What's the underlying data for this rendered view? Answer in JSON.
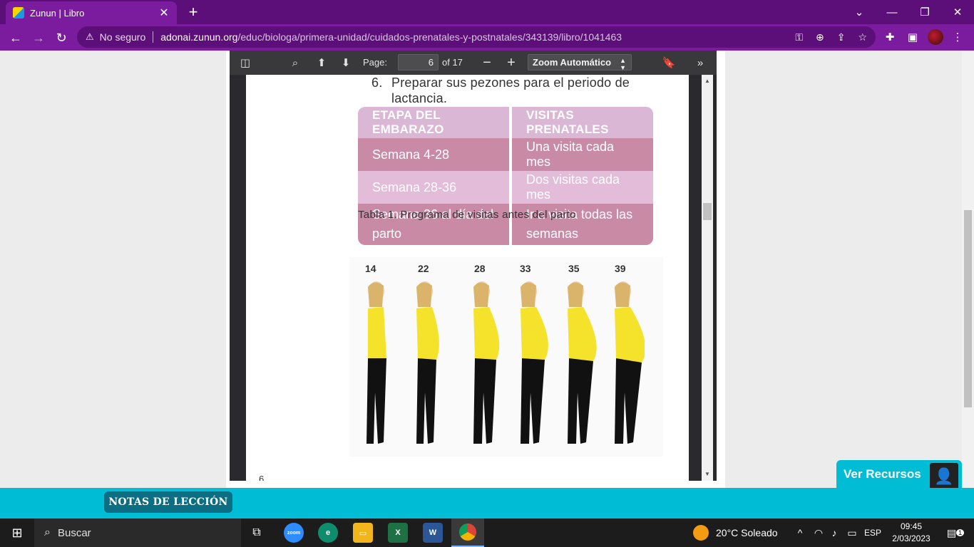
{
  "browser": {
    "tab_title": "Zunun | Libro",
    "new_tab": "+",
    "insecure": "No seguro",
    "url_domain": "adonai.zunun.org",
    "url_path": "/educ/biologa/primera-unidad/cuidados-prenatales-y-postnatales/343139/libro/1041463"
  },
  "pdf": {
    "page_label": "Page:",
    "page_current": "6",
    "page_total": "of 17",
    "zoom": "Zoom Automático",
    "page_number_footer": "6"
  },
  "content": {
    "item_number": "6.",
    "item_text": "Preparar sus pezones para el periodo de lactancia.",
    "table": {
      "headers": [
        "ETAPA DEL EMBARAZO",
        "VISITAS PRENATALES"
      ],
      "rows": [
        [
          "Semana 4-28",
          "Una visita cada mes"
        ],
        [
          "Semana 28-36",
          "Dos visitas cada mes"
        ],
        [
          "Semana 36 al día del parto",
          "Ir a visita todas las semanas"
        ]
      ]
    },
    "caption": "Tabla 1. Programa de visitas antes del parto",
    "weeks": [
      "14",
      "22",
      "28",
      "33",
      "35",
      "39"
    ]
  },
  "footer": {
    "notes_button": "NOTAS DE LECCIÓN",
    "resources_button": "Ver Recursos"
  },
  "taskbar": {
    "search": "Buscar",
    "weather": "20°C  Soleado",
    "lang": "ESP",
    "time": "09:45",
    "date": "2/03/2023",
    "notif_count": "1"
  },
  "colors": {
    "tab_bar": "#5c0f79",
    "address_bar": "#7a1c9d",
    "table_header": "#dbb7d6",
    "table_dark": "#c98aa5",
    "table_light": "#e2bcd9",
    "footer_bar": "#00bcd4"
  }
}
